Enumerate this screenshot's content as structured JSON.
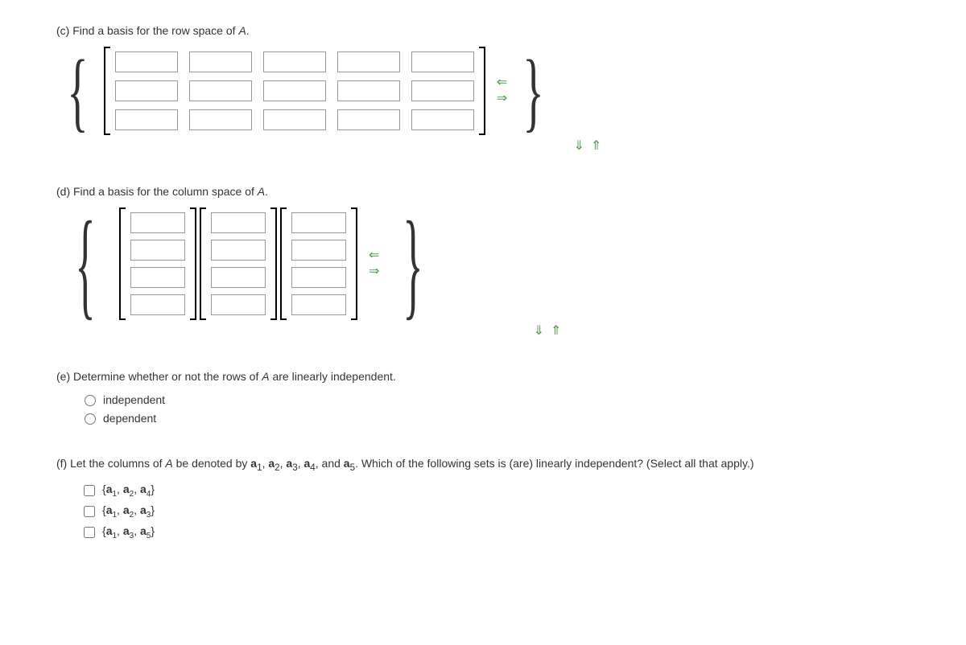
{
  "c": {
    "prompt_prefix": "(c) Find a basis for the row space of ",
    "matrix_var": "A",
    "prompt_suffix": ".",
    "rows": 3,
    "cols": 5
  },
  "d": {
    "prompt_prefix": "(d) Find a basis for the column space of ",
    "matrix_var": "A",
    "prompt_suffix": ".",
    "vectors": 3,
    "rows": 4
  },
  "e": {
    "prompt_prefix": "(e) Determine whether or not the rows of ",
    "matrix_var": "A",
    "prompt_suffix": " are linearly independent.",
    "options": [
      "independent",
      "dependent"
    ]
  },
  "f": {
    "prompt_p1": "(f) Let the columns of ",
    "matrix_var": "A",
    "prompt_p2": " be denoted by ",
    "denote_html": "a1, a2, a3, a4, and a5",
    "prompt_p3": ". Which of the following sets is (are) linearly independent? (Select all that apply.)",
    "options": [
      "{a1, a2, a4}",
      "{a1, a2, a3}",
      "{a1, a3, a5}"
    ]
  },
  "arrows": {
    "left": "⇐",
    "right": "⇒",
    "down": "⇓",
    "up": "⇑"
  }
}
